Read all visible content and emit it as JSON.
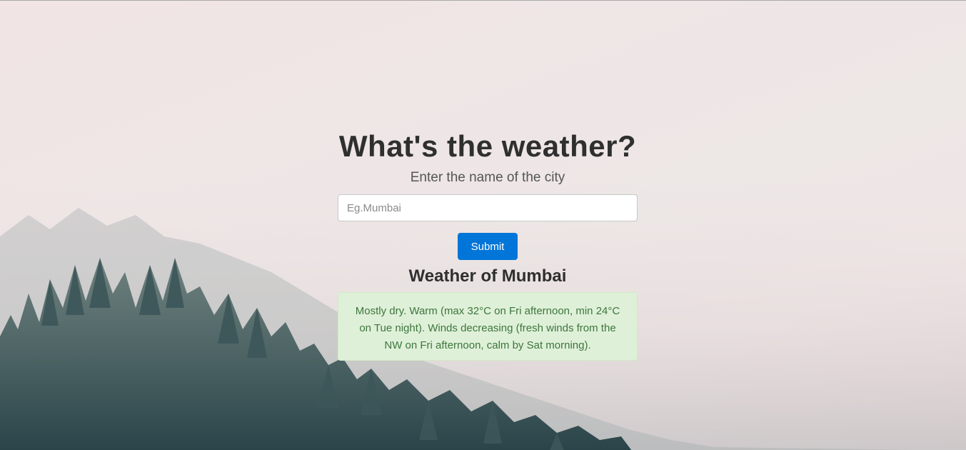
{
  "header": {
    "title": "What's the weather?",
    "subtitle": "Enter the name of the city"
  },
  "form": {
    "city_placeholder": "Eg.Mumbai",
    "city_value": "",
    "submit_label": "Submit"
  },
  "result": {
    "heading": "Weather of Mumbai",
    "forecast": "Mostly dry. Warm (max 32°C on Fri afternoon, min 24°C on Tue night). Winds decreasing (fresh winds from the NW on Fri afternoon, calm by Sat morning)."
  },
  "colors": {
    "primary_button": "#0275d8",
    "alert_background": "#dff0d8",
    "alert_text": "#3c763d",
    "heading_text": "#2f2f2f"
  }
}
